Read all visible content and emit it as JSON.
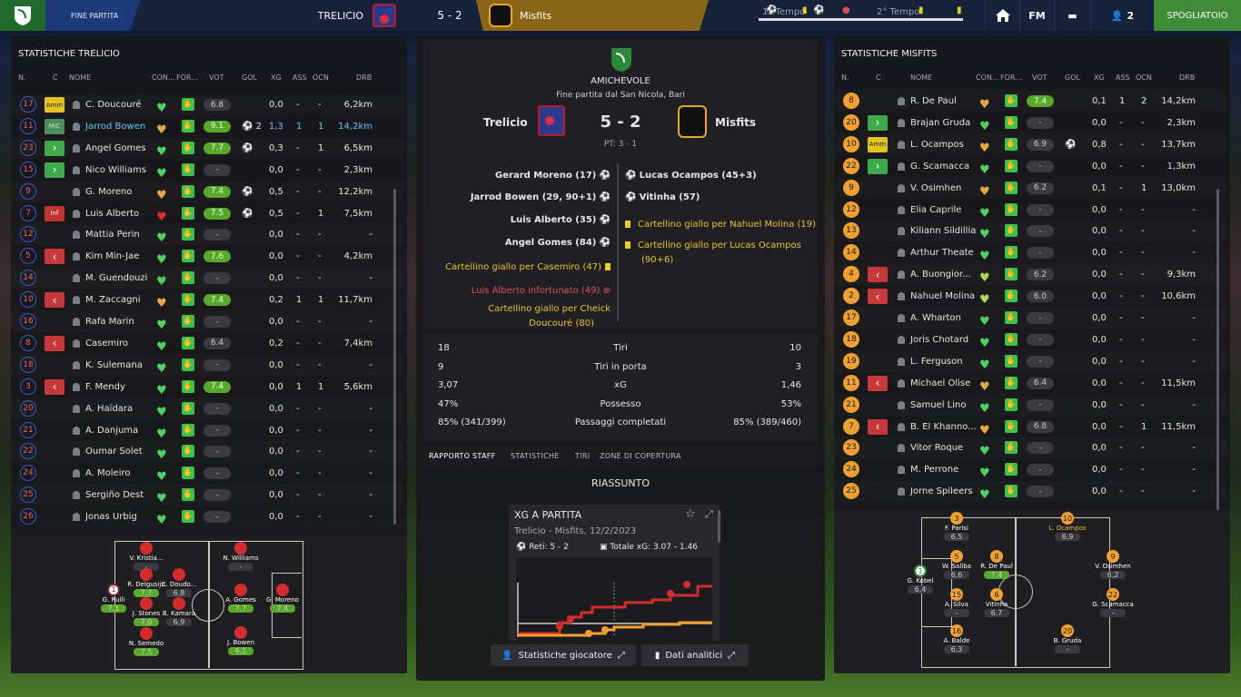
{
  "topbar": {
    "phase": "FINE PARTITA",
    "home": "TRELICIO",
    "score": "5 - 2",
    "away": "Misfits",
    "first_half": "1° Tempo",
    "second_half": "2° Tempo",
    "fm": "FM",
    "count": "2",
    "spogliatoio": "SPOGLIATOIO"
  },
  "left": {
    "title": "STATISTICHE TRELICIO",
    "headers": {
      "n": "N.",
      "c": "C",
      "nome": "NOME",
      "con": "CON...",
      "for": "FOR...",
      "vot": "VOT",
      "gol": "GOL",
      "xg": "XG",
      "ass": "ASS",
      "ocn": "OCN",
      "drb": "DRB"
    },
    "rows": [
      {
        "n": "17",
        "badge": "Amm",
        "bt": "amm",
        "name": "C. Doucouré",
        "heart": "green",
        "vot": "6.8",
        "vg": false,
        "gol": "",
        "xg": "0,0",
        "ass": "-",
        "ocn": "-",
        "drb": "6,2km"
      },
      {
        "n": "11",
        "badge": "MiC",
        "bt": "mic",
        "name": "Jarrod Bowen",
        "heart": "orange",
        "vot": "9.1",
        "vg": true,
        "gol": "⚽ 2",
        "xg": "1,3",
        "ass": "1",
        "ocn": "1",
        "drb": "14,2km",
        "hl": true
      },
      {
        "n": "23",
        "badge": "›",
        "bt": "in",
        "name": "Angel Gomes",
        "heart": "green",
        "vot": "7.7",
        "vg": true,
        "gol": "⚽",
        "xg": "0,3",
        "ass": "-",
        "ocn": "1",
        "drb": "6,5km"
      },
      {
        "n": "15",
        "badge": "›",
        "bt": "in",
        "name": "Nico Williams",
        "heart": "green",
        "vot": "-",
        "vg": false,
        "gol": "",
        "xg": "0,0",
        "ass": "-",
        "ocn": "-",
        "drb": "2,3km"
      },
      {
        "n": "9",
        "badge": "",
        "bt": "",
        "name": "G. Moreno",
        "heart": "orange",
        "vot": "7.4",
        "vg": true,
        "gol": "⚽",
        "xg": "0,5",
        "ass": "-",
        "ocn": "-",
        "drb": "12,2km"
      },
      {
        "n": "7",
        "badge": "Inf",
        "bt": "inf",
        "name": "Luis Alberto",
        "heart": "red",
        "vot": "7.5",
        "vg": true,
        "gol": "⚽",
        "xg": "0,5",
        "ass": "-",
        "ocn": "1",
        "drb": "7,5km"
      },
      {
        "n": "12",
        "badge": "",
        "bt": "",
        "name": "Mattia Perin",
        "heart": "green",
        "vot": "-",
        "vg": false,
        "gol": "",
        "xg": "0,0",
        "ass": "-",
        "ocn": "-",
        "drb": "-"
      },
      {
        "n": "5",
        "badge": "‹",
        "bt": "out",
        "name": "Kim Min-Jae",
        "heart": "green",
        "vot": "7.6",
        "vg": true,
        "gol": "",
        "xg": "0,0",
        "ass": "-",
        "ocn": "-",
        "drb": "4,2km"
      },
      {
        "n": "14",
        "badge": "",
        "bt": "",
        "name": "M. Guendouzi",
        "heart": "green",
        "vot": "-",
        "vg": false,
        "gol": "",
        "xg": "0,0",
        "ass": "-",
        "ocn": "-",
        "drb": "-"
      },
      {
        "n": "10",
        "badge": "‹",
        "bt": "out",
        "name": "M. Zaccagni",
        "heart": "orange",
        "vot": "7.4",
        "vg": true,
        "gol": "",
        "xg": "0,2",
        "ass": "1",
        "ocn": "1",
        "drb": "11,7km"
      },
      {
        "n": "16",
        "badge": "",
        "bt": "",
        "name": "Rafa Marin",
        "heart": "green",
        "vot": "-",
        "vg": false,
        "gol": "",
        "xg": "0,0",
        "ass": "-",
        "ocn": "-",
        "drb": "-"
      },
      {
        "n": "8",
        "badge": "‹",
        "bt": "out",
        "name": "Casemiro",
        "heart": "green",
        "vot": "6.4",
        "vg": false,
        "gol": "",
        "xg": "0,2",
        "ass": "-",
        "ocn": "-",
        "drb": "7,4km"
      },
      {
        "n": "18",
        "badge": "",
        "bt": "",
        "name": "K. Sulemana",
        "heart": "green",
        "vot": "-",
        "vg": false,
        "gol": "",
        "xg": "0,0",
        "ass": "-",
        "ocn": "-",
        "drb": "-"
      },
      {
        "n": "3",
        "badge": "‹",
        "bt": "out",
        "name": "F. Mendy",
        "heart": "green",
        "vot": "7.4",
        "vg": true,
        "gol": "",
        "xg": "0,0",
        "ass": "1",
        "ocn": "1",
        "drb": "5,6km"
      },
      {
        "n": "20",
        "badge": "",
        "bt": "",
        "name": "A. Haïdara",
        "heart": "green",
        "vot": "-",
        "vg": false,
        "gol": "",
        "xg": "0,0",
        "ass": "-",
        "ocn": "-",
        "drb": "-"
      },
      {
        "n": "21",
        "badge": "",
        "bt": "",
        "name": "A. Danjuma",
        "heart": "green",
        "vot": "-",
        "vg": false,
        "gol": "",
        "xg": "0,0",
        "ass": "-",
        "ocn": "-",
        "drb": "-"
      },
      {
        "n": "22",
        "badge": "",
        "bt": "",
        "name": "Oumar Solet",
        "heart": "green",
        "vot": "-",
        "vg": false,
        "gol": "",
        "xg": "0,0",
        "ass": "-",
        "ocn": "-",
        "drb": "-"
      },
      {
        "n": "24",
        "badge": "",
        "bt": "",
        "name": "A. Moleiro",
        "heart": "green",
        "vot": "-",
        "vg": false,
        "gol": "",
        "xg": "0,0",
        "ass": "-",
        "ocn": "-",
        "drb": "-"
      },
      {
        "n": "25",
        "badge": "",
        "bt": "",
        "name": "Sergiño Dest",
        "heart": "green",
        "vot": "-",
        "vg": false,
        "gol": "",
        "xg": "0,0",
        "ass": "-",
        "ocn": "-",
        "drb": "-"
      },
      {
        "n": "26",
        "badge": "",
        "bt": "",
        "name": "Jonas Urbig",
        "heart": "green",
        "vot": "-",
        "vg": false,
        "gol": "",
        "xg": "0,0",
        "ass": "-",
        "ocn": "-",
        "drb": "-"
      }
    ],
    "pitch": [
      {
        "name": "V. Kristia...",
        "r": "-"
      },
      {
        "name": "R. Delgusijn",
        "r": "7,7"
      },
      {
        "name": "C. Doudo...",
        "r": "6,8"
      },
      {
        "name": "G. Rulli",
        "r": "7,1",
        "n": "1"
      },
      {
        "name": "J. Stones",
        "r": "7,0"
      },
      {
        "name": "B. Kamara",
        "r": "6,9"
      },
      {
        "name": "N. Semedo",
        "r": "7,5"
      },
      {
        "name": "N. Williams",
        "r": "-"
      },
      {
        "name": "A. Gomes",
        "r": "7,7"
      },
      {
        "name": "G. Moreno",
        "r": "7,4"
      },
      {
        "name": "J. Bowen",
        "r": "9,1"
      }
    ]
  },
  "mid": {
    "match_type": "AMICHEVOLE",
    "subtitle": "Fine partita dal San Nicola, Bari",
    "home": "Trelicio",
    "away": "Misfits",
    "score": "5 - 2",
    "ht": "PT: 3 - 1",
    "home_events": [
      {
        "t": "Gerard Moreno (17)",
        "k": "goal"
      },
      {
        "t": "Jarrod Bowen (29, 90+1)",
        "k": "goal"
      },
      {
        "t": "Luis Alberto (35)",
        "k": "goal"
      },
      {
        "t": "Angel Gomes (84)",
        "k": "goal"
      },
      {
        "t": "Cartellino giallo per Casemiro (47)",
        "k": "yellow"
      },
      {
        "t": "Luis Alberto infortunato (49)",
        "k": "injury"
      },
      {
        "t": "Cartellino giallo per Cheick",
        "k": "yellow"
      },
      {
        "t": "Doucouré (80)",
        "k": "yellow2"
      }
    ],
    "away_events": [
      {
        "t": "Lucas Ocampos (45+3)",
        "k": "goal"
      },
      {
        "t": "Vitinha (57)",
        "k": "goal"
      },
      {
        "t": "Cartellino giallo per Nahuel Molina (19)",
        "k": "yellow"
      },
      {
        "t": "Cartellino giallo per Lucas Ocampos",
        "k": "yellow"
      },
      {
        "t": "(90+6)",
        "k": "yellow2"
      }
    ],
    "stats": [
      {
        "l": "18",
        "m": "Tiri",
        "r": "10"
      },
      {
        "l": "9",
        "m": "Tiri in porta",
        "r": "3"
      },
      {
        "l": "3,07",
        "m": "xG",
        "r": "1,46"
      },
      {
        "l": "47%",
        "m": "Possesso",
        "r": "53%"
      },
      {
        "l": "85% (341/399)",
        "m": "Passaggi completati",
        "r": "85% (389/460)"
      }
    ],
    "tabs": [
      "RAPPORTO STAFF",
      "STATISTICHE",
      "TIRI",
      "ZONE DI COPERTURA"
    ],
    "summary": "RIASSUNTO",
    "card": {
      "title": "XG A PARTITA",
      "sub": "Trelicio - Misfits, 12/2/2023",
      "reti": "Reti: 5 - 2",
      "xg": "Totale xG: 3.07 - 1.46"
    },
    "btn1": "Statistiche giocatore",
    "btn2": "Dati analitici"
  },
  "right": {
    "title": "STATISTICHE MISFITS",
    "headers": {
      "n": "N.",
      "c": "C",
      "nome": "NOME",
      "con": "CON...",
      "for": "FOR...",
      "vot": "VOT",
      "gol": "GOL",
      "xg": "XG",
      "ass": "ASS",
      "ocn": "OCN",
      "drb": "DRB"
    },
    "rows": [
      {
        "n": "8",
        "badge": "",
        "bt": "",
        "name": "R. De Paul",
        "heart": "orange",
        "vot": "7.4",
        "vg": true,
        "gol": "",
        "xg": "0,1",
        "ass": "1",
        "ocn": "2",
        "drb": "14,2km"
      },
      {
        "n": "20",
        "badge": "›",
        "bt": "in",
        "name": "Brajan Gruda",
        "heart": "green",
        "vot": "-",
        "vg": false,
        "gol": "",
        "xg": "0,0",
        "ass": "-",
        "ocn": "-",
        "drb": "2,3km"
      },
      {
        "n": "10",
        "badge": "Amm",
        "bt": "amm",
        "name": "L. Ocampos",
        "heart": "orange",
        "vot": "6.9",
        "vg": false,
        "gol": "⚽",
        "xg": "0,8",
        "ass": "-",
        "ocn": "-",
        "drb": "13,7km"
      },
      {
        "n": "22",
        "badge": "›",
        "bt": "in",
        "name": "G. Scamacca",
        "heart": "green",
        "vot": "-",
        "vg": false,
        "gol": "",
        "xg": "0,0",
        "ass": "-",
        "ocn": "-",
        "drb": "1,3km"
      },
      {
        "n": "9",
        "badge": "",
        "bt": "",
        "name": "V. Osimhen",
        "heart": "orange",
        "vot": "6.2",
        "vg": false,
        "gol": "",
        "xg": "0,1",
        "ass": "-",
        "ocn": "1",
        "drb": "13,0km"
      },
      {
        "n": "12",
        "badge": "",
        "bt": "",
        "name": "Elia Caprile",
        "heart": "green",
        "vot": "-",
        "vg": false,
        "gol": "",
        "xg": "0,0",
        "ass": "-",
        "ocn": "-",
        "drb": "-"
      },
      {
        "n": "13",
        "badge": "",
        "bt": "",
        "name": "Kiliann Sildillia",
        "heart": "green",
        "vot": "-",
        "vg": false,
        "gol": "",
        "xg": "0,0",
        "ass": "-",
        "ocn": "-",
        "drb": "-"
      },
      {
        "n": "14",
        "badge": "",
        "bt": "",
        "name": "Arthur Theate",
        "heart": "green",
        "vot": "-",
        "vg": false,
        "gol": "",
        "xg": "0,0",
        "ass": "-",
        "ocn": "-",
        "drb": "-"
      },
      {
        "n": "4",
        "badge": "‹",
        "bt": "out",
        "name": "A. Buongior...",
        "heart": "lime",
        "vot": "6.2",
        "vg": false,
        "gol": "",
        "xg": "0,0",
        "ass": "-",
        "ocn": "-",
        "drb": "9,3km"
      },
      {
        "n": "2",
        "badge": "‹",
        "bt": "out",
        "name": "Nahuel Molina",
        "heart": "lime",
        "vot": "6.0",
        "vg": false,
        "gol": "",
        "xg": "0,0",
        "ass": "-",
        "ocn": "-",
        "drb": "10,6km"
      },
      {
        "n": "17",
        "badge": "",
        "bt": "",
        "name": "A. Wharton",
        "heart": "green",
        "vot": "-",
        "vg": false,
        "gol": "",
        "xg": "0,0",
        "ass": "-",
        "ocn": "-",
        "drb": "-"
      },
      {
        "n": "18",
        "badge": "",
        "bt": "",
        "name": "Joris Chotard",
        "heart": "green",
        "vot": "-",
        "vg": false,
        "gol": "",
        "xg": "0,0",
        "ass": "-",
        "ocn": "-",
        "drb": "-"
      },
      {
        "n": "19",
        "badge": "",
        "bt": "",
        "name": "L. Ferguson",
        "heart": "green",
        "vot": "-",
        "vg": false,
        "gol": "",
        "xg": "0,0",
        "ass": "-",
        "ocn": "-",
        "drb": "-"
      },
      {
        "n": "11",
        "badge": "‹",
        "bt": "out",
        "name": "Michael Olise",
        "heart": "orange",
        "vot": "6.4",
        "vg": false,
        "gol": "",
        "xg": "0,0",
        "ass": "-",
        "ocn": "-",
        "drb": "11,5km"
      },
      {
        "n": "21",
        "badge": "",
        "bt": "",
        "name": "Samuel Lino",
        "heart": "green",
        "vot": "-",
        "vg": false,
        "gol": "",
        "xg": "0,0",
        "ass": "-",
        "ocn": "-",
        "drb": "-"
      },
      {
        "n": "7",
        "badge": "‹",
        "bt": "out",
        "name": "B. El Khanno...",
        "heart": "orange",
        "vot": "6.8",
        "vg": false,
        "gol": "",
        "xg": "0,0",
        "ass": "-",
        "ocn": "1",
        "drb": "11,5km"
      },
      {
        "n": "23",
        "badge": "",
        "bt": "",
        "name": "Vitor Roque",
        "heart": "green",
        "vot": "-",
        "vg": false,
        "gol": "",
        "xg": "0,0",
        "ass": "-",
        "ocn": "-",
        "drb": "-"
      },
      {
        "n": "24",
        "badge": "",
        "bt": "",
        "name": "M. Perrone",
        "heart": "green",
        "vot": "-",
        "vg": false,
        "gol": "",
        "xg": "0,0",
        "ass": "-",
        "ocn": "-",
        "drb": "-"
      },
      {
        "n": "25",
        "badge": "",
        "bt": "",
        "name": "Jorne Spileers",
        "heart": "green",
        "vot": "-",
        "vg": false,
        "gol": "",
        "xg": "0,0",
        "ass": "-",
        "ocn": "-",
        "drb": "-"
      }
    ],
    "pitch": [
      {
        "n": "3",
        "name": "F. Parisi",
        "r": "6,5"
      },
      {
        "n": "5",
        "name": "W. Saliba",
        "r": "6,6"
      },
      {
        "n": "8",
        "name": "R. De Paul",
        "r": "7,4"
      },
      {
        "n": "10",
        "name": "L. Ocampos",
        "r": "6,9"
      },
      {
        "n": "1",
        "name": "G. Kobel",
        "r": "6,4"
      },
      {
        "n": "15",
        "name": "A. Silva",
        "r": "-"
      },
      {
        "n": "6",
        "name": "Vitinha",
        "r": "6,7"
      },
      {
        "n": "9",
        "name": "V. Osimhen",
        "r": "6,2"
      },
      {
        "n": "22",
        "name": "G. Scamacca",
        "r": "-"
      },
      {
        "n": "16",
        "name": "A. Balde",
        "r": "6,3"
      },
      {
        "n": "20",
        "name": "B. Gruda",
        "r": "-"
      }
    ]
  }
}
